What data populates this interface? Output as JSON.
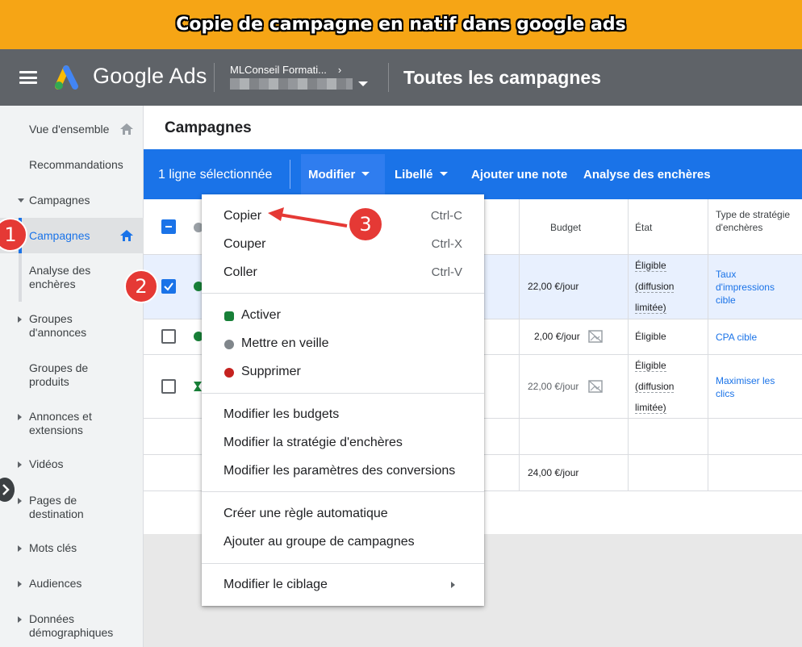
{
  "banner": {
    "text": "Copie de campagne en natif dans google ads"
  },
  "header": {
    "brand": "Google Ads",
    "account_name": "MLConseil Formati...",
    "account_chevron": "›",
    "page_title": "Toutes les campagnes",
    "colors": {
      "bar": "#5f6368",
      "logo_blue": "#4285f4",
      "logo_yellow": "#fbbc04",
      "logo_green": "#34a853"
    }
  },
  "sidebar": {
    "items": [
      {
        "label": "Vue d'ensemble",
        "icon": "home-icon"
      },
      {
        "label": "Recommandations"
      },
      {
        "label": "Campagnes",
        "expanded": true
      },
      {
        "label": "Campagnes",
        "active": true,
        "icon": "home-icon"
      },
      {
        "label": "Analyse des enchères"
      },
      {
        "label": "Groupes d'annonces"
      },
      {
        "label": "Groupes de produits"
      },
      {
        "label": "Annonces et extensions"
      },
      {
        "label": "Vidéos"
      },
      {
        "label": "Pages de destination"
      },
      {
        "label": "Mots clés"
      },
      {
        "label": "Audiences"
      },
      {
        "label": "Données démographiques"
      }
    ]
  },
  "main": {
    "section_title": "Campagnes",
    "actionbar": {
      "selection": "1 ligne sélectionnée",
      "modifier": "Modifier",
      "libelle": "Libellé",
      "ajouter_note": "Ajouter une note",
      "analyse": "Analyse des enchères"
    },
    "table": {
      "headers": {
        "budget": "Budget",
        "etat": "État",
        "type": "Type de stratégie d'enchères"
      },
      "rows": [
        {
          "budget": "22,00 €/jour",
          "etat": [
            "Éligible",
            "(diffusion",
            "limitée)"
          ],
          "type": "Taux d'impressions cible",
          "checked": true
        },
        {
          "budget": "2,00 €/jour",
          "etat": [
            "Éligible"
          ],
          "type": "CPA cible",
          "checked": false
        },
        {
          "budget": "22,00 €/jour",
          "etat": [
            "Éligible",
            "(diffusion",
            "limitée)"
          ],
          "type": "Maximiser les clics",
          "checked": false
        }
      ],
      "total_budget": "24,00 €/jour"
    }
  },
  "menu": {
    "copier": {
      "label": "Copier",
      "shortcut": "Ctrl-C"
    },
    "couper": {
      "label": "Couper",
      "shortcut": "Ctrl-X"
    },
    "coller": {
      "label": "Coller",
      "shortcut": "Ctrl-V"
    },
    "activer": "Activer",
    "veille": "Mettre en veille",
    "supprimer": "Supprimer",
    "budgets": "Modifier les budgets",
    "strategie": "Modifier la stratégie d'enchères",
    "conversions": "Modifier les paramètres des conversions",
    "regle": "Créer une règle automatique",
    "groupe": "Ajouter au groupe de campagnes",
    "ciblage": "Modifier le ciblage"
  },
  "annotations": {
    "step1": "1",
    "step2": "2",
    "step3": "3",
    "color": "#e53935"
  }
}
